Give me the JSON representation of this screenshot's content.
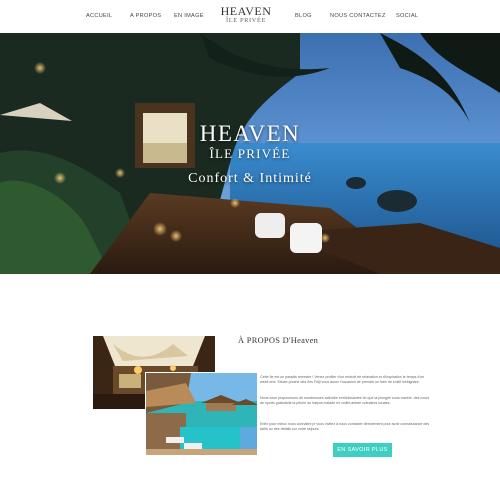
{
  "nav": {
    "items": [
      "ACCUEIL",
      "A PROPOS",
      "EN IMAGE",
      "BLOG",
      "NOUS CONTACTEZ",
      "SOCIAL"
    ]
  },
  "logo": {
    "title": "HEAVEN",
    "subtitle": "ÎLE PRIVÉE"
  },
  "hero": {
    "title": "HEAVEN",
    "subtitle": "ÎLE PRIVÉE",
    "tagline": "Confort & Intimité"
  },
  "about": {
    "title": "À PROPOS D'Heaven",
    "paragraphs": [
      "Cette île est un paradis terrestre ! Venez profiter d'un endroit de relaxation et d'inspiration le temps d'un week end. Située proche des îles Fidji vous aurez l'occasion de prendre un bain de soleil lesbignant.",
      "Nous vous proposerons de nombreuses activités enrichissantes tel que la plongée sous marine, des cours de sports gratuitsde la pêche au harpon,balade en voilier,artiste culinaires locales.",
      "Enfin pour mieux nous connaitre je vous invitez à nous contacter directement pour avoir connaissance des tarifs ou des détails sur votre séjours."
    ],
    "button_label": "EN SAVOIR PLUS"
  },
  "colors": {
    "accent": "#3fcfc2",
    "text": "#333333"
  }
}
